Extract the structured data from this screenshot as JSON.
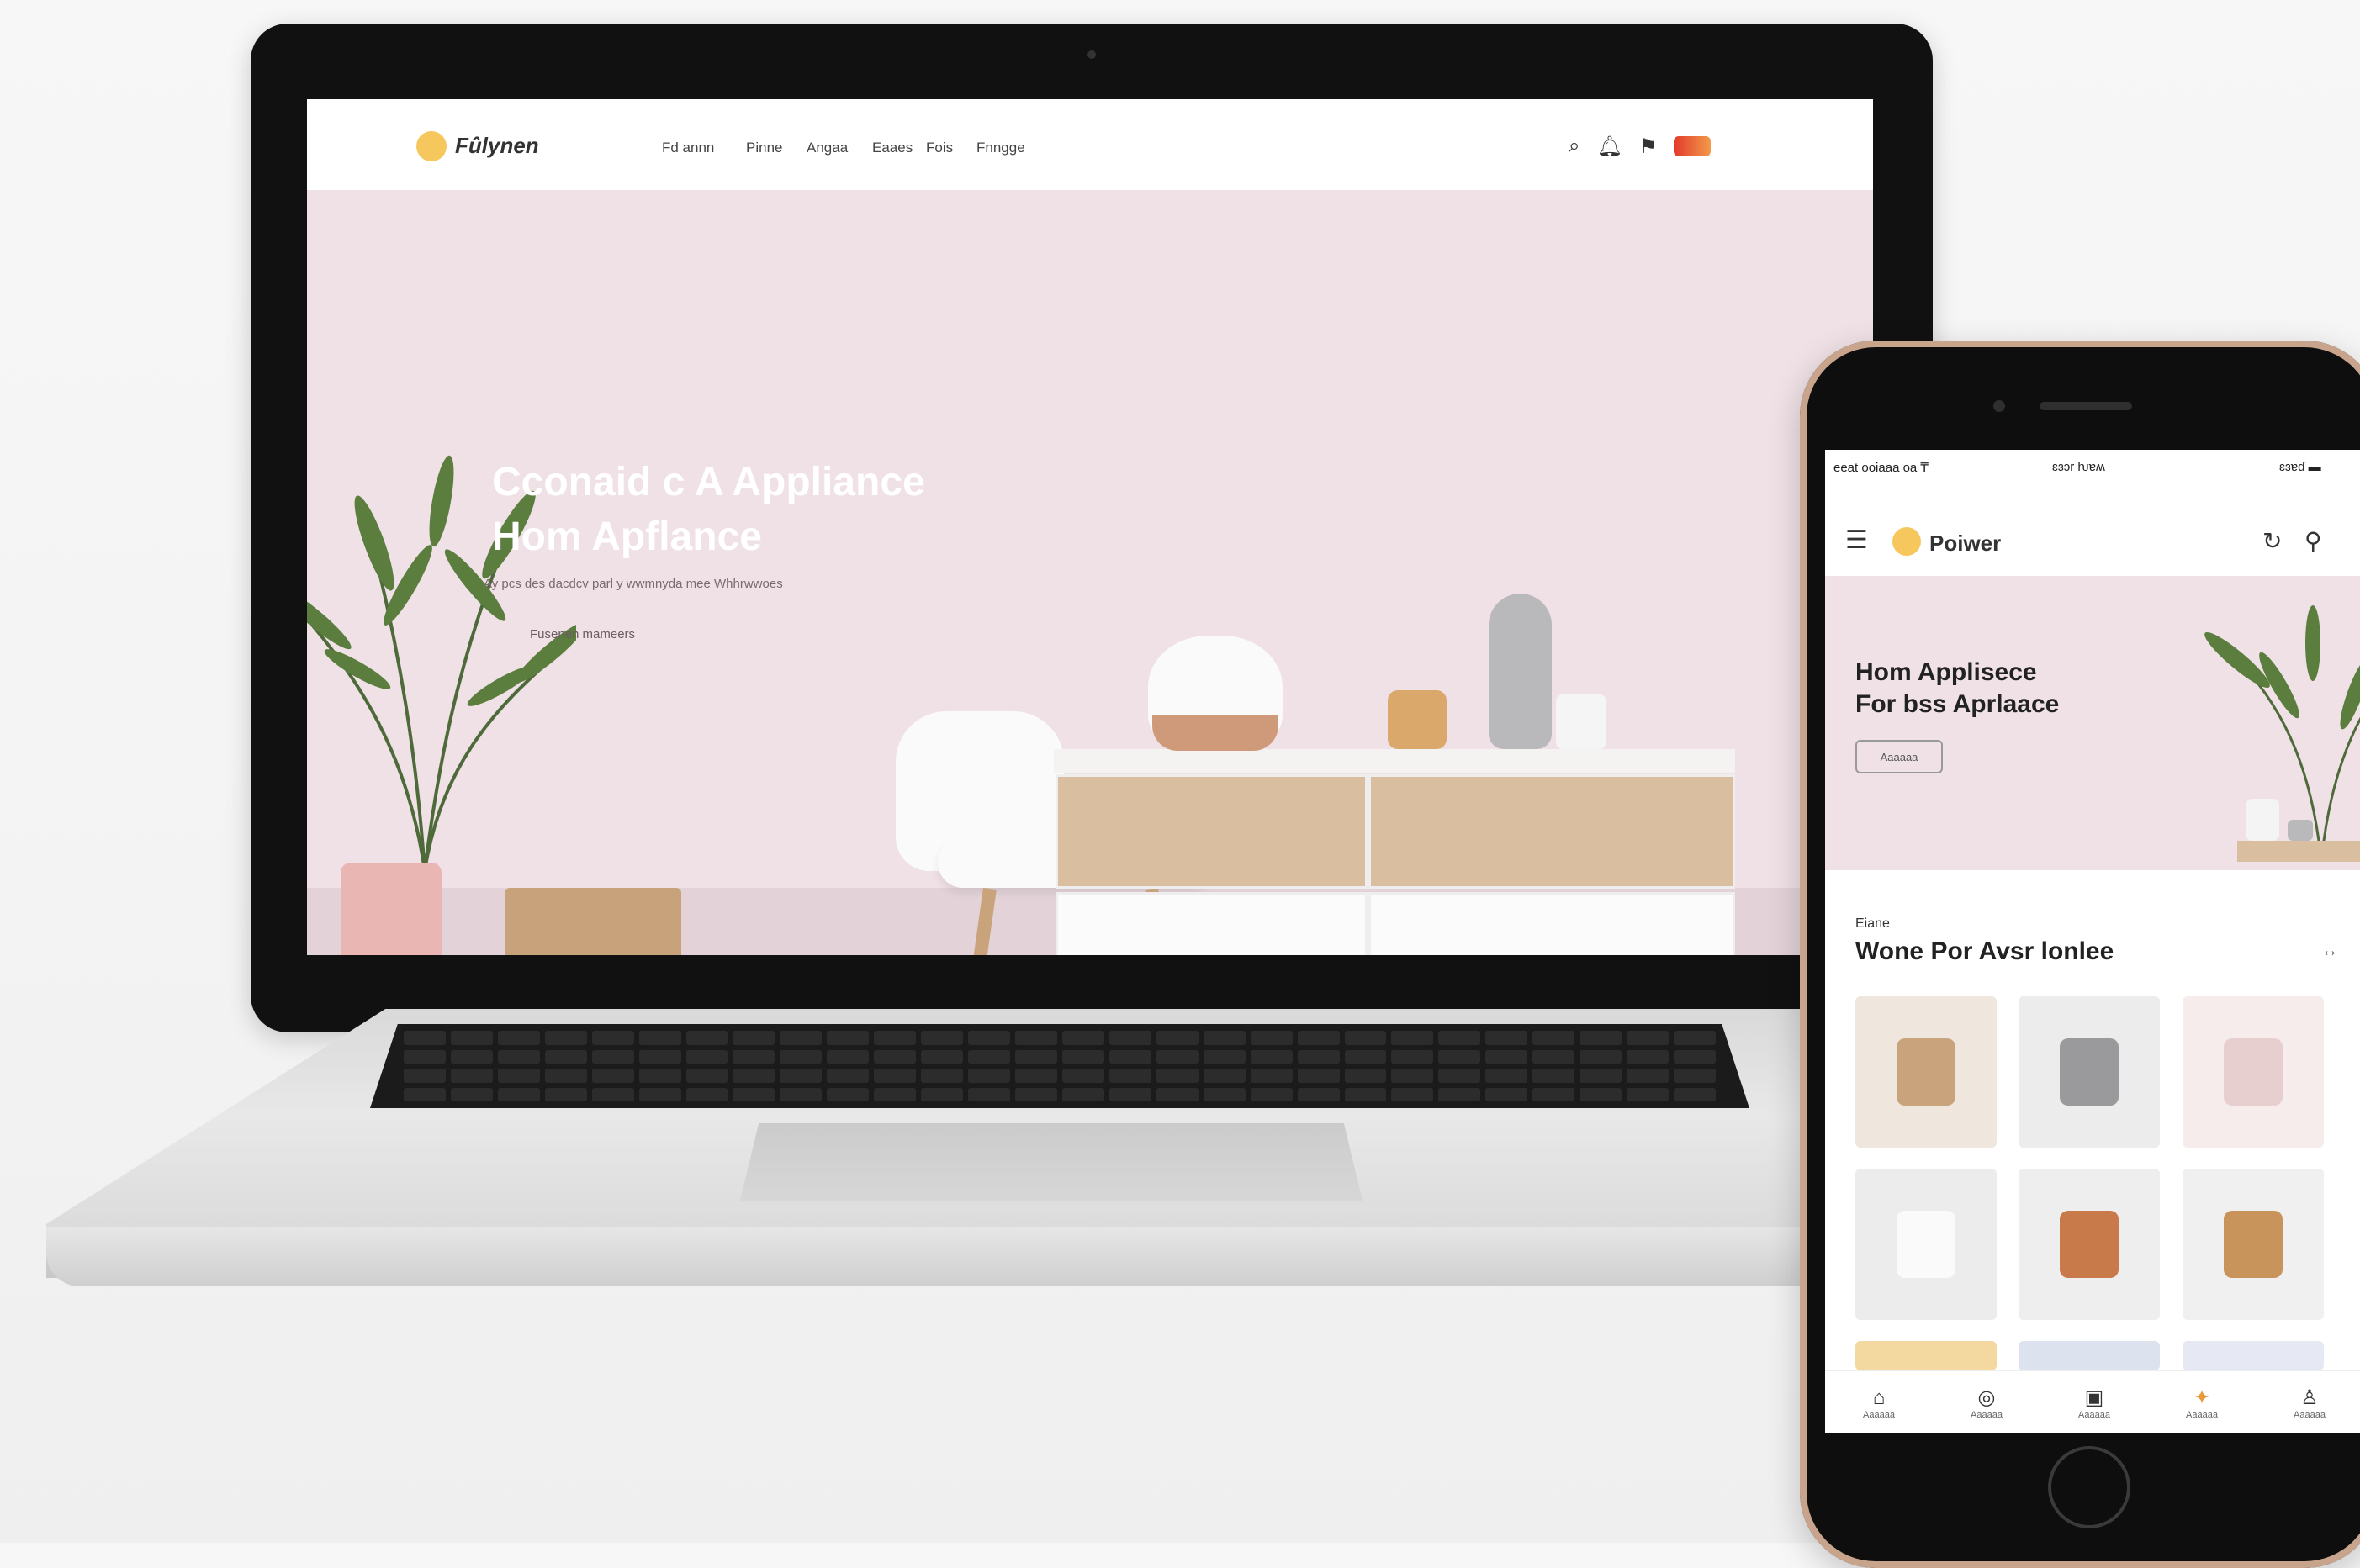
{
  "laptop": {
    "site": {
      "brand": "Fûlynen",
      "nav_links": [
        "Fd annn",
        "Pinne",
        "Angaa",
        "Eaaes",
        "Fois",
        "Fnngge"
      ],
      "hero": {
        "title_line1": "Cconaid c A Appliance",
        "title_line2": "Hom Apflance",
        "subtitle": "Ay pcs des dacdcv parl y wwmnyda mee Whhrwwoes",
        "cta_link": "Fusenen mameers"
      },
      "icons": [
        "search-icon",
        "bell-icon",
        "bookmark-icon",
        "flag-icon"
      ]
    }
  },
  "phone": {
    "status": {
      "left": "eeat ooiaaa oa  ₸",
      "center": "ɛɜɔr ƕɐʍ",
      "right": "ɛɜɐɗ ▬"
    },
    "brand": "Poiwer",
    "hero": {
      "title_line1": "Hom Applisece",
      "title_line2": "For bss Aprlaace",
      "button": "Aaaaaa"
    },
    "section": {
      "kicker": "Eiane",
      "title": "Wone Por Avsr lonlee",
      "more": "↔"
    },
    "tiles": [
      {
        "name": "plant-tile",
        "color": "#efe6de"
      },
      {
        "name": "chair-tile",
        "color": "#ececec"
      },
      {
        "name": "pink-chair-tile",
        "color": "#f6ecec"
      },
      {
        "name": "kettle-tile",
        "color": "#ececec"
      },
      {
        "name": "mug-tile",
        "color": "#eeeeee"
      },
      {
        "name": "box-tile",
        "color": "#f0f0f0"
      }
    ],
    "tabs": [
      {
        "label": "Aaaaaa",
        "icon": "⌂"
      },
      {
        "label": "Aaaaaa",
        "icon": "◎"
      },
      {
        "label": "Aaaaaa",
        "icon": "▣"
      },
      {
        "label": "Aaaaaa",
        "icon": "✦"
      },
      {
        "label": "Aaaaaa",
        "icon": "♙"
      }
    ]
  }
}
